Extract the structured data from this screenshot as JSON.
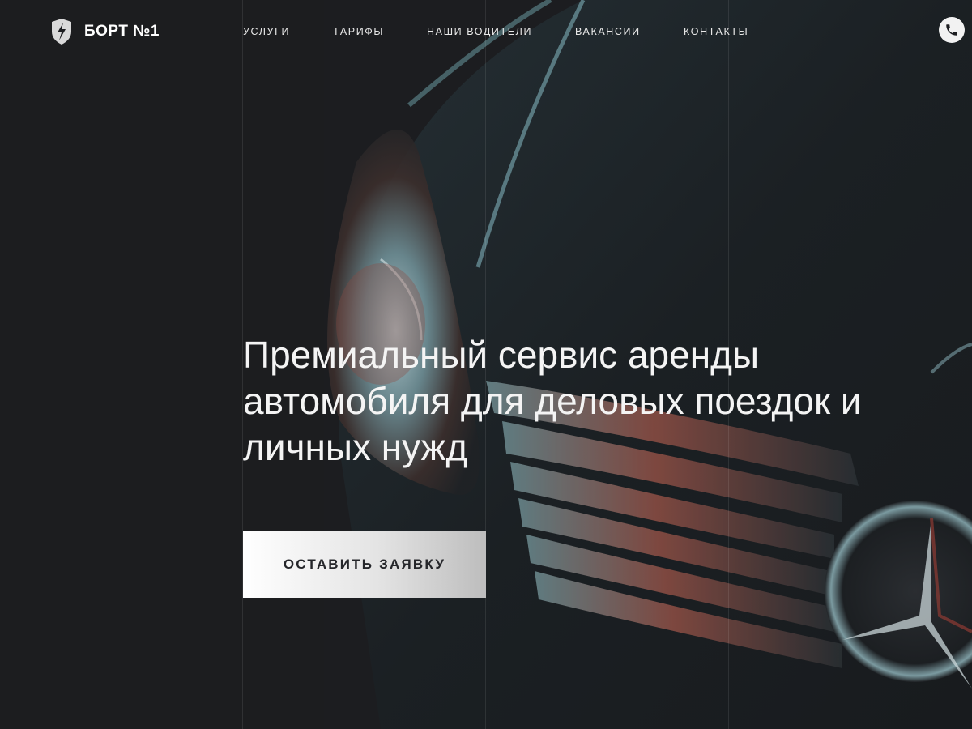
{
  "brand": {
    "name": "БОРТ №1",
    "logo_icon": "shield-bolt-icon"
  },
  "nav": {
    "items": [
      "УСЛУГИ",
      "ТАРИФЫ",
      "НАШИ ВОДИТЕЛИ",
      "ВАКАНСИИ",
      "КОНТАКТЫ"
    ]
  },
  "header": {
    "phone_icon": "phone-icon"
  },
  "hero": {
    "headline": "Премиальный сервис аренды автомобиля для деловых поездок и личных нужд",
    "cta_label": "ОСТАВИТЬ ЗАЯВКУ",
    "image": "car-headlight-grille-photo"
  },
  "colors": {
    "background": "#1c1d20",
    "text": "#ffffff",
    "button_text": "#25262a",
    "car_accent": "#7a3a30"
  }
}
